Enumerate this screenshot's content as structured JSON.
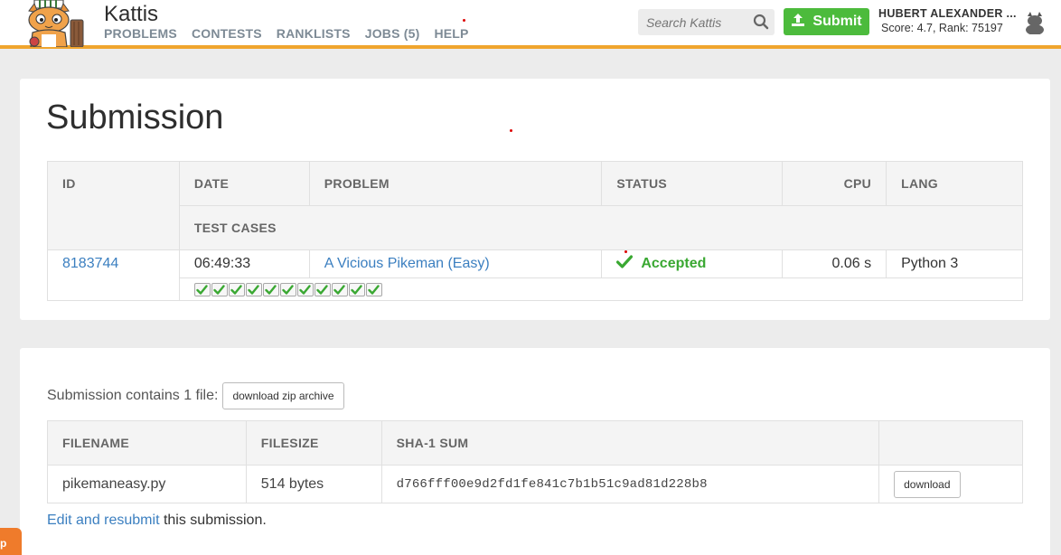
{
  "header": {
    "brand": "Kattis",
    "nav": [
      "PROBLEMS",
      "CONTESTS",
      "RANKLISTS",
      "JOBS (5)",
      "HELP"
    ],
    "search_placeholder": "Search Kattis",
    "submit_label": "Submit",
    "user_name": "HUBERT ALEXANDER ...",
    "user_score": "Score: 4.7, Rank: 75197"
  },
  "submission": {
    "title": "Submission",
    "columns": {
      "id": "ID",
      "date": "DATE",
      "problem": "PROBLEM",
      "status": "STATUS",
      "cpu": "CPU",
      "lang": "LANG",
      "test_cases": "TEST CASES"
    },
    "row": {
      "id": "8183744",
      "date": "06:49:33",
      "problem": "A Vicious Pikeman (Easy)",
      "status": "Accepted",
      "cpu": "0.06 s",
      "lang": "Python 3"
    },
    "test_cases_passed": 11
  },
  "files": {
    "summary": "Submission contains 1 file:",
    "download_zip_label": "download zip archive",
    "columns": {
      "filename": "FILENAME",
      "filesize": "FILESIZE",
      "sha1": "SHA-1 SUM"
    },
    "rows": [
      {
        "filename": "pikemaneasy.py",
        "filesize": "514 bytes",
        "sha1": "d766fff00e9d2fd1fe841c7b1b51c9ad81d228b8",
        "download_label": "download"
      }
    ],
    "edit_link": "Edit and resubmit",
    "edit_suffix": " this submission."
  },
  "help_tab": "p",
  "colors": {
    "accent_orange": "#f0a52e",
    "submit_green": "#4cbb3c",
    "accepted_green": "#3aa832",
    "link_blue": "#3b7fc0"
  }
}
